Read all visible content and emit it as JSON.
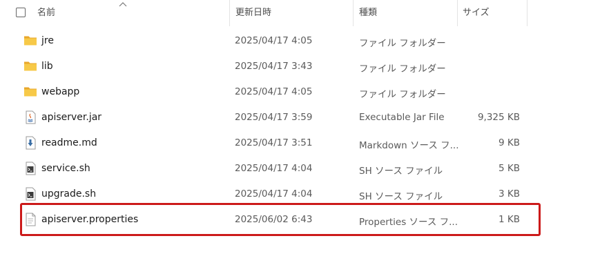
{
  "columns": {
    "name": "名前",
    "modified": "更新日時",
    "type": "種類",
    "size": "サイズ"
  },
  "files": [
    {
      "name": "jre",
      "modified": "2025/04/17 4:05",
      "type": "ファイル フォルダー",
      "size": "",
      "icon": "folder-icon"
    },
    {
      "name": "lib",
      "modified": "2025/04/17 3:43",
      "type": "ファイル フォルダー",
      "size": "",
      "icon": "folder-icon"
    },
    {
      "name": "webapp",
      "modified": "2025/04/17 4:05",
      "type": "ファイル フォルダー",
      "size": "",
      "icon": "folder-icon"
    },
    {
      "name": "apiserver.jar",
      "modified": "2025/04/17 3:59",
      "type": "Executable Jar File",
      "size": "9,325 KB",
      "icon": "java-jar-icon"
    },
    {
      "name": "readme.md",
      "modified": "2025/04/17 3:51",
      "type": "Markdown ソース フ...",
      "size": "9 KB",
      "icon": "markdown-file-icon"
    },
    {
      "name": "service.sh",
      "modified": "2025/04/17 4:04",
      "type": "SH ソース ファイル",
      "size": "5 KB",
      "icon": "shell-script-icon"
    },
    {
      "name": "upgrade.sh",
      "modified": "2025/04/17 4:04",
      "type": "SH ソース ファイル",
      "size": "3 KB",
      "icon": "shell-script-icon"
    },
    {
      "name": "apiserver.properties",
      "modified": "2025/06/02 6:43",
      "type": "Properties ソース フ...",
      "size": "1 KB",
      "icon": "text-file-icon"
    }
  ],
  "colors": {
    "highlight_border": "#cc1a1a",
    "folder": "#f5c242"
  }
}
